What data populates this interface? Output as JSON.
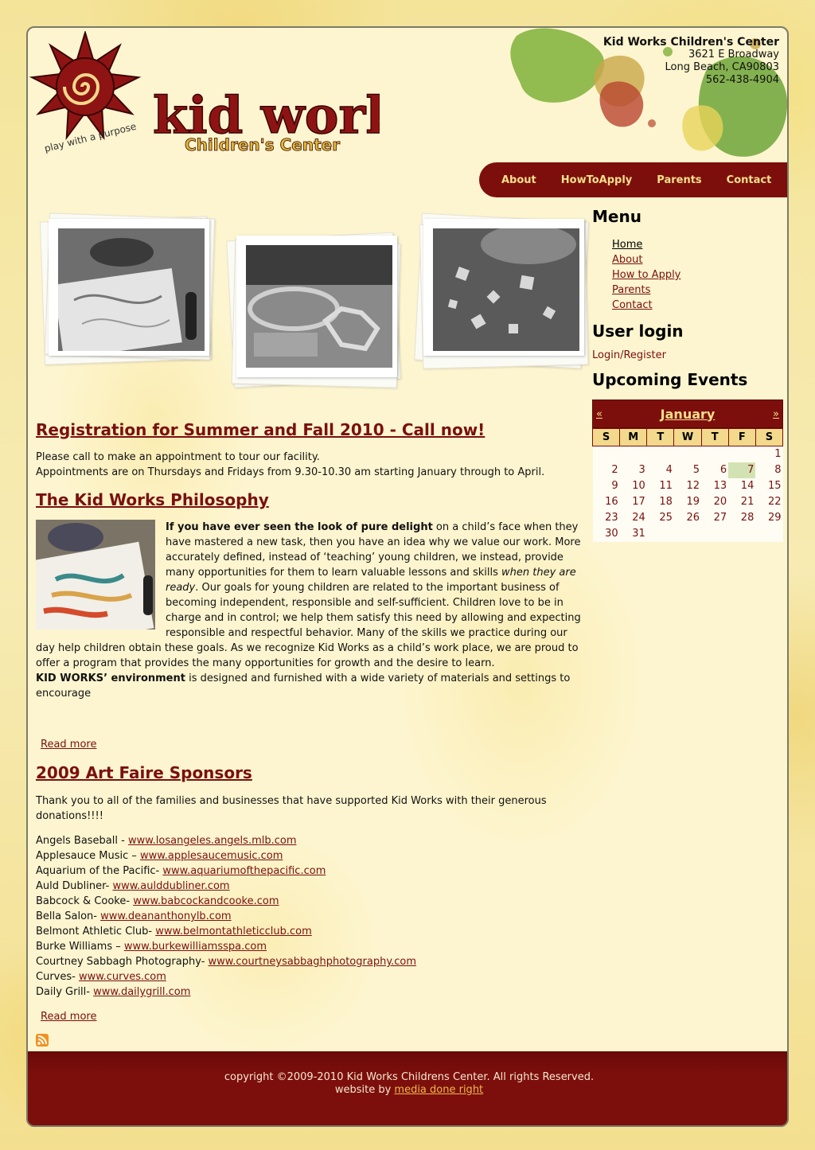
{
  "header": {
    "logo_text": "kid works",
    "logo_subtitle": "Children's Center",
    "logo_tagline": "play with a purpose",
    "address": {
      "name": "Kid Works Children's Center",
      "street": "3621 E Broadway",
      "city": "Long Beach, CA90803",
      "phone": "562-438-4904"
    },
    "nav": [
      "About",
      "HowToApply",
      "Parents",
      "Contact"
    ]
  },
  "main": {
    "registration": {
      "title": "Registration for Summer and Fall 2010 - Call now!",
      "line1": "Please call to make an appointment to tour our facility.",
      "line2": "Appointments are on Thursdays and Fridays from 9.30-10.30 am starting January through to April."
    },
    "philosophy": {
      "title": "The Kid Works Philosophy",
      "bold_open": "If you have ever seen the look of pure delight",
      "text1": " on a child’s face when they have mastered a new task, then you have an idea why we value our work. More accurately defined, instead of ‘teaching’ young children, we instead, provide many opportunities for them to learn valuable lessons and skills ",
      "italic": "when they are ready",
      "text2": ". Our goals for young children are related to the important business of becoming independent, responsible and self-sufficient. Children love to be in charge and in control; we help them satisfy this need by allowing and expecting responsible and respectful behavior. Many of the skills we practice during our day help children obtain these goals. As we recognize Kid Works as a child’s work place, we are proud to offer a program that provides the many opportunities for growth and the desire to learn.",
      "bold_env": "KID WORKS’ environment",
      "text3": " is designed and furnished with a wide variety of materials and settings to encourage",
      "read_more": "Read more"
    },
    "sponsors": {
      "title": "2009 Art Faire Sponsors",
      "intro": "Thank you to all of the families and businesses that have supported Kid Works with their generous donations!!!!",
      "items": [
        {
          "name": "Angels Baseball - ",
          "url": "www.losangeles.angels.mlb.com"
        },
        {
          "name": "Applesauce Music – ",
          "url": "www.applesaucemusic.com"
        },
        {
          "name": "Aquarium of the Pacific- ",
          "url": "www.aquariumofthepacific.com"
        },
        {
          "name": "Auld Dubliner- ",
          "url": "www.aulddubliner.com"
        },
        {
          "name": "Babcock & Cooke- ",
          "url": "www.babcockandcooke.com"
        },
        {
          "name": "Bella Salon- ",
          "url": "www.deananthonylb.com"
        },
        {
          "name": "Belmont Athletic Club- ",
          "url": "www.belmontathleticclub.com"
        },
        {
          "name": "Burke Williams – ",
          "url": "www.burkewilliamsspa.com"
        },
        {
          "name": "Courtney Sabbagh Photography- ",
          "url": "www.courtneysabbaghphotography.com"
        },
        {
          "name": "Curves- ",
          "url": "www.curves.com"
        },
        {
          "name": "Daily Grill- ",
          "url": "www.dailygrill.com"
        }
      ],
      "read_more": "Read more"
    }
  },
  "sidebar": {
    "menu_title": "Menu",
    "menu_items": [
      "Home",
      "About",
      "How to Apply",
      "Parents",
      "Contact"
    ],
    "login_title": "User login",
    "login_link": "Login/Register",
    "events_title": "Upcoming Events",
    "calendar": {
      "prev": "«",
      "next": "»",
      "month": "January",
      "weekdays": [
        "S",
        "M",
        "T",
        "W",
        "T",
        "F",
        "S"
      ],
      "weeks": [
        [
          "",
          "",
          "",
          "",
          "",
          "",
          "1"
        ],
        [
          "2",
          "3",
          "4",
          "5",
          "6",
          "7",
          "8"
        ],
        [
          "9",
          "10",
          "11",
          "12",
          "13",
          "14",
          "15"
        ],
        [
          "16",
          "17",
          "18",
          "19",
          "20",
          "21",
          "22"
        ],
        [
          "23",
          "24",
          "25",
          "26",
          "27",
          "28",
          "29"
        ],
        [
          "30",
          "31",
          "",
          "",
          "",
          "",
          ""
        ]
      ],
      "today": "7"
    }
  },
  "footer": {
    "copyright": "copyright ©2009-2010 Kid Works Childrens Center. All rights Reserved.",
    "website_by": "website by ",
    "credit": "media done right"
  },
  "colors": {
    "brand_red": "#7c0f0c",
    "nav_text": "#f7df8c",
    "link": "#7a1010",
    "today_highlight": "#d3e2b3"
  }
}
